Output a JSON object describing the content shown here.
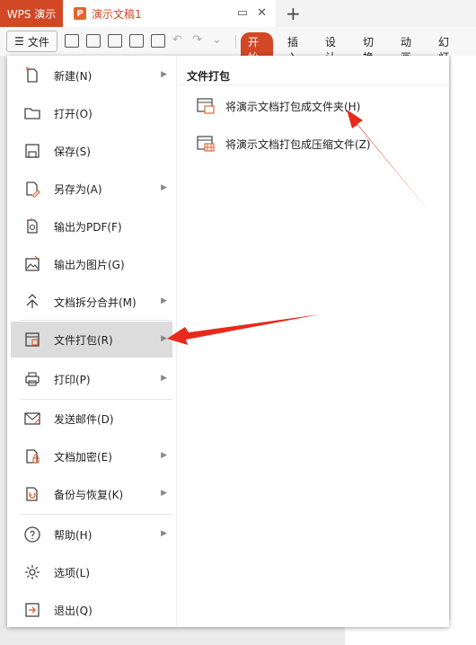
{
  "titlebar": {
    "app_tab": "WPS 演示",
    "doc_tab": "演示文稿1",
    "doc_icon": "P",
    "new_tab": "+"
  },
  "toolbar": {
    "file_label": "文件",
    "tabs": [
      "开始",
      "插入",
      "设计",
      "切换",
      "动画",
      "幻灯"
    ],
    "active_tab": "开始"
  },
  "file_menu": {
    "items": [
      {
        "label": "新建(N)",
        "icon": "new-file-icon",
        "submenu": true
      },
      {
        "label": "打开(O)",
        "icon": "folder-open-icon",
        "submenu": false
      },
      {
        "label": "保存(S)",
        "icon": "save-icon",
        "submenu": false
      },
      {
        "label": "另存为(A)",
        "icon": "save-as-icon",
        "submenu": true
      },
      {
        "label": "输出为PDF(F)",
        "icon": "pdf-export-icon",
        "submenu": false
      },
      {
        "label": "输出为图片(G)",
        "icon": "image-export-icon",
        "submenu": false
      },
      {
        "label": "文档拆分合并(M)",
        "icon": "split-merge-icon",
        "submenu": true
      },
      {
        "label": "文件打包(R)",
        "icon": "package-icon",
        "submenu": true
      },
      {
        "label": "打印(P)",
        "icon": "printer-icon",
        "submenu": true
      },
      {
        "label": "发送邮件(D)",
        "icon": "mail-icon",
        "submenu": false
      },
      {
        "label": "文档加密(E)",
        "icon": "encrypt-icon",
        "submenu": true
      },
      {
        "label": "备份与恢复(K)",
        "icon": "backup-icon",
        "submenu": true
      },
      {
        "label": "帮助(H)",
        "icon": "help-icon",
        "submenu": true
      },
      {
        "label": "选项(L)",
        "icon": "gear-icon",
        "submenu": false
      },
      {
        "label": "退出(Q)",
        "icon": "exit-icon",
        "submenu": false
      }
    ],
    "active_item": "文件打包(R)"
  },
  "submenu": {
    "header": "文件打包",
    "items": [
      {
        "label": "将演示文档打包成文件夹(H)",
        "icon": "pack-folder-icon"
      },
      {
        "label": "将演示文档打包成压缩文件(Z)",
        "icon": "pack-zip-icon"
      }
    ]
  },
  "colors": {
    "accent": "#d24726",
    "annotation_arrow": "#e8291c"
  }
}
